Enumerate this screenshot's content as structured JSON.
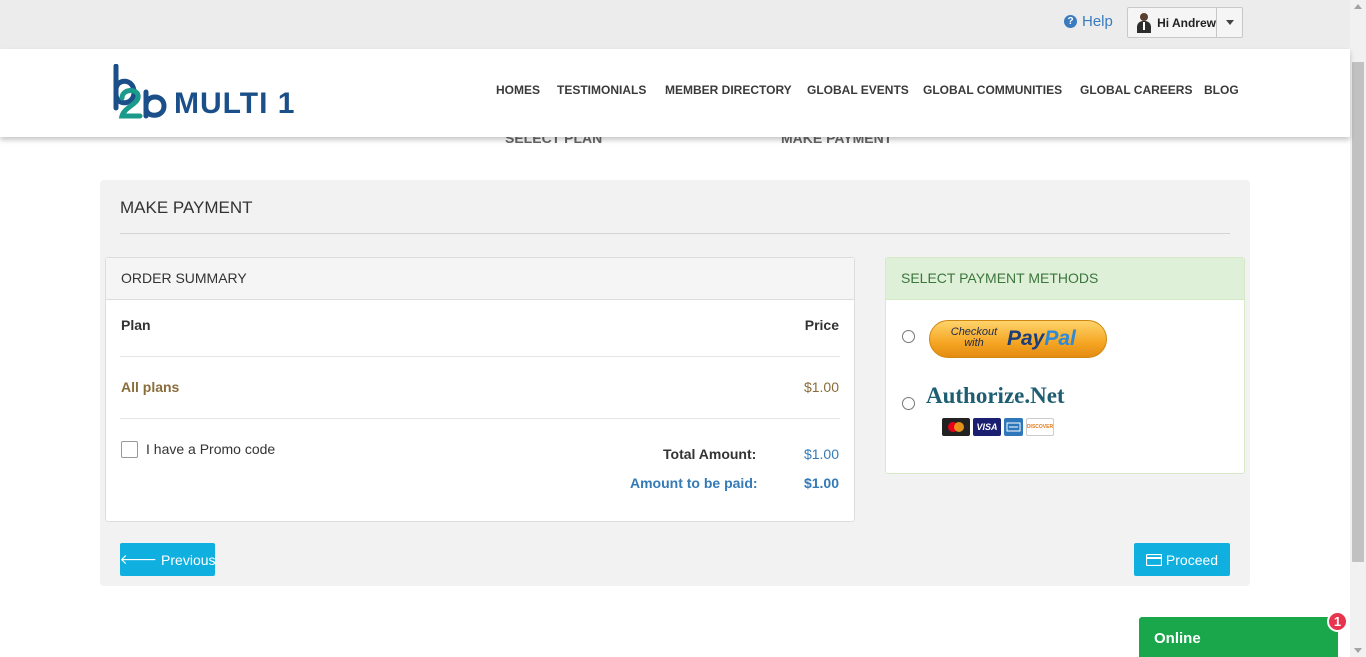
{
  "topbar": {
    "help_label": "Help",
    "help_icon": "question-circle-icon",
    "user_greeting": "Hi Andrew"
  },
  "header": {
    "logo_text": "MULTI 1",
    "logo_mark": "b2b",
    "nav": [
      "HOMES",
      "TESTIMONIALS",
      "MEMBER DIRECTORY",
      "GLOBAL EVENTS",
      "GLOBAL COMMUNITIES",
      "GLOBAL CAREERS",
      "BLOG"
    ]
  },
  "steps": [
    "SELECT PLAN",
    "MAKE PAYMENT"
  ],
  "payment": {
    "title": "MAKE PAYMENT",
    "order_summary": {
      "heading": "ORDER SUMMARY",
      "col_plan": "Plan",
      "col_price": "Price",
      "item_name": "All plans",
      "item_price": "$1.00",
      "promo_label": "I have a Promo code",
      "total_label": "Total Amount:",
      "total_value": "$1.00",
      "due_label": "Amount to be paid:",
      "due_value": "$1.00"
    },
    "methods": {
      "heading": "SELECT PAYMENT METHODS",
      "paypal_small": "Checkout with",
      "paypal_pay": "Pay",
      "paypal_pal": "Pal",
      "authorize_name": "Authorize.Net",
      "cards": [
        "MasterCard",
        "VISA",
        "AMEX",
        "DISCOVER"
      ]
    },
    "buttons": {
      "previous": "Previous",
      "proceed": "Proceed"
    }
  },
  "chat": {
    "label": "Online",
    "badge": "1"
  },
  "colors": {
    "accent": "#0fb0e0",
    "link_blue": "#337ab7",
    "plan_brown": "#8a6d3b",
    "success_green": "#1aa64a"
  }
}
